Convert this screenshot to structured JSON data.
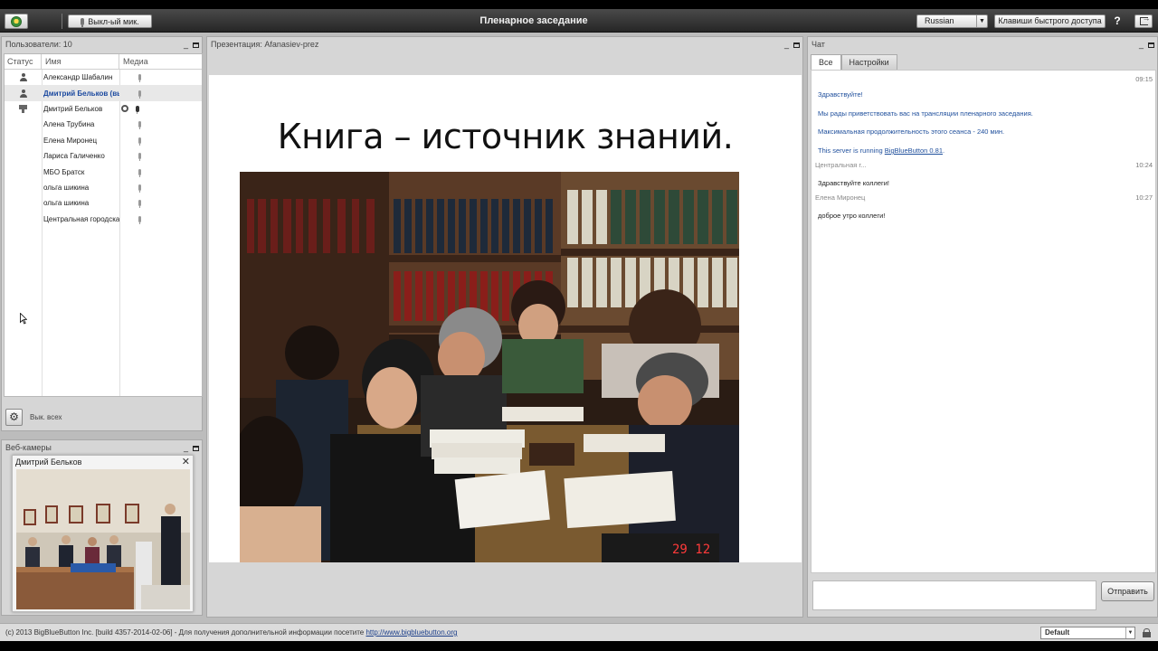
{
  "header": {
    "mic_button_label": "Выкл-ый мик.",
    "title": "Пленарное заседание",
    "language": "Russian",
    "shortcuts_label": "Клавиши быстрого доступа",
    "help_label": "?"
  },
  "users": {
    "title": "Пользователи: 10",
    "col_status": "Статус",
    "col_name": "Имя",
    "col_media": "Медиа",
    "rows": [
      {
        "name": "Александр Шабалин",
        "status": "person",
        "cam": false,
        "mic": "off",
        "selected": false
      },
      {
        "name": "Дмитрий Бельков (вы)",
        "status": "person",
        "cam": false,
        "mic": "off",
        "selected": true
      },
      {
        "name": "Дмитрий Бельков",
        "status": "presenter",
        "cam": true,
        "mic": "on",
        "selected": false
      },
      {
        "name": "Алена Трубина",
        "status": "none",
        "cam": false,
        "mic": "off",
        "selected": false
      },
      {
        "name": "Елена  Миронец",
        "status": "none",
        "cam": false,
        "mic": "off",
        "selected": false
      },
      {
        "name": "Лариса Галиченко",
        "status": "none",
        "cam": false,
        "mic": "off",
        "selected": false
      },
      {
        "name": "МБО Братск",
        "status": "none",
        "cam": false,
        "mic": "off",
        "selected": false
      },
      {
        "name": "ольга шикина",
        "status": "none",
        "cam": false,
        "mic": "off",
        "selected": false
      },
      {
        "name": "ольга шикина",
        "status": "none",
        "cam": false,
        "mic": "off",
        "selected": false
      },
      {
        "name": "Центральная городская б",
        "status": "none",
        "cam": false,
        "mic": "off",
        "selected": false
      }
    ],
    "mute_all_label": "Вык. всех"
  },
  "webcams": {
    "title": "Веб-камеры",
    "window_title": "Дмитрий Бельков"
  },
  "presentation": {
    "title": "Презентация: Afanasiev-prez",
    "slide_heading": "Книга – источник знаний.",
    "photo_date_stamp": "29 12"
  },
  "chat": {
    "title": "Чат",
    "tab_all": "Все",
    "tab_settings": "Настройки",
    "messages": [
      {
        "time": "09:15",
        "sender": "",
        "lines": [
          {
            "text": "Здравствуйте!",
            "system": true
          },
          {
            "text": "Мы рады приветствовать вас на трансляции пленарного заседания.",
            "system": true
          },
          {
            "text": "Максимальная продолжительность этого сеанса - 240 мин.",
            "system": true
          }
        ]
      },
      {
        "server_prefix": "This server is running ",
        "server_link": "BigBlueButton 0.81",
        "server_suffix": "."
      },
      {
        "time": "10:24",
        "sender": "Центральная г...",
        "text": "Здравствуйте коллеги!"
      },
      {
        "time": "10:27",
        "sender": "Елена  Миронец",
        "text": "доброе утро коллеги!"
      }
    ],
    "send_label": "Отправить"
  },
  "footer": {
    "copyright_prefix": "(c) 2013 BigBlueButton Inc. [build 4357-2014-02-06] - Для получения дополнительной информации посетите ",
    "copyright_link": "http://www.bigbluebutton.org",
    "layout": "Default"
  },
  "colors": {
    "header_bg": "#2e2e2e",
    "panel_bg": "#d6d6d6",
    "selected_user": "#1c4aa0",
    "system_message": "#1f4f9c"
  }
}
